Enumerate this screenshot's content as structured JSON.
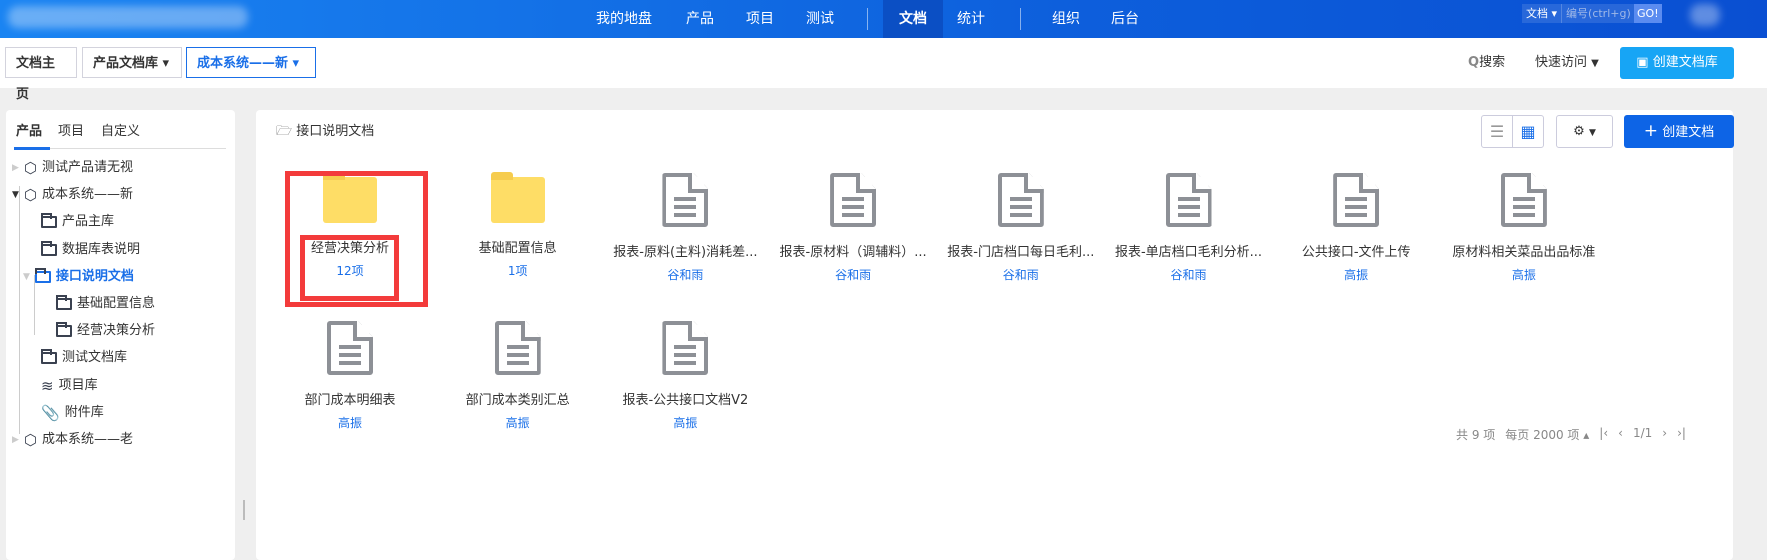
{
  "header": {
    "nav": [
      "我的地盘",
      "产品",
      "项目",
      "测试",
      "文档",
      "统计",
      "组织",
      "后台"
    ],
    "active": "文档",
    "search_type": "文档",
    "search_placeholder": "编号(ctrl+g)",
    "go": "GO!"
  },
  "breadcrumb": {
    "items": [
      "文档主页",
      "产品文档库",
      "成本系统——新"
    ],
    "search": "搜索",
    "quick_access": "快速访问",
    "create_lib": "创建文档库"
  },
  "sidebar": {
    "tabs": [
      "产品",
      "项目",
      "自定义"
    ],
    "tree": [
      {
        "label": "测试产品请无视",
        "icon": "cube",
        "level": 0,
        "toggle": "collapsed"
      },
      {
        "label": "成本系统——新",
        "icon": "cube",
        "level": 0,
        "toggle": "expanded"
      },
      {
        "label": "产品主库",
        "icon": "folder",
        "level": 1
      },
      {
        "label": "数据库表说明",
        "icon": "folder",
        "level": 1
      },
      {
        "label": "接口说明文档",
        "icon": "folder",
        "level": 1,
        "active": true,
        "toggle": "expanded"
      },
      {
        "label": "基础配置信息",
        "icon": "folder",
        "level": 2
      },
      {
        "label": "经营决策分析",
        "icon": "folder",
        "level": 2
      },
      {
        "label": "测试文档库",
        "icon": "folder",
        "level": 1
      },
      {
        "label": "项目库",
        "icon": "layers",
        "level": 1
      },
      {
        "label": "附件库",
        "icon": "paperclip",
        "level": 1
      },
      {
        "label": "成本系统——老",
        "icon": "cube",
        "level": 0,
        "toggle": "collapsed"
      }
    ]
  },
  "main": {
    "path": "接口说明文档",
    "create_doc": "创建文档",
    "items": [
      {
        "type": "folder",
        "name": "经营决策分析",
        "sub": "12项",
        "highlighted": true
      },
      {
        "type": "folder",
        "name": "基础配置信息",
        "sub": "1项"
      },
      {
        "type": "doc",
        "name": "报表-原料(主料)消耗差...",
        "sub": "谷和雨"
      },
      {
        "type": "doc",
        "name": "报表-原材料（调辅料）...",
        "sub": "谷和雨"
      },
      {
        "type": "doc",
        "name": "报表-门店档口每日毛利...",
        "sub": "谷和雨"
      },
      {
        "type": "doc",
        "name": "报表-单店档口毛利分析...",
        "sub": "谷和雨"
      },
      {
        "type": "doc",
        "name": "公共接口-文件上传",
        "sub": "高振"
      },
      {
        "type": "doc",
        "name": "原材料相关菜品出品标准",
        "sub": "高振"
      },
      {
        "type": "doc",
        "name": "部门成本明细表",
        "sub": "高振"
      },
      {
        "type": "doc",
        "name": "部门成本类别汇总",
        "sub": "高振"
      },
      {
        "type": "doc",
        "name": "报表-公共接口文档V2",
        "sub": "高振"
      }
    ],
    "pager": {
      "total": "共 9 项",
      "per_page": "每页 2000 项",
      "page": "1/1"
    }
  },
  "colors": {
    "accent": "#1a6fe8",
    "highlight": "#f33b3b"
  }
}
